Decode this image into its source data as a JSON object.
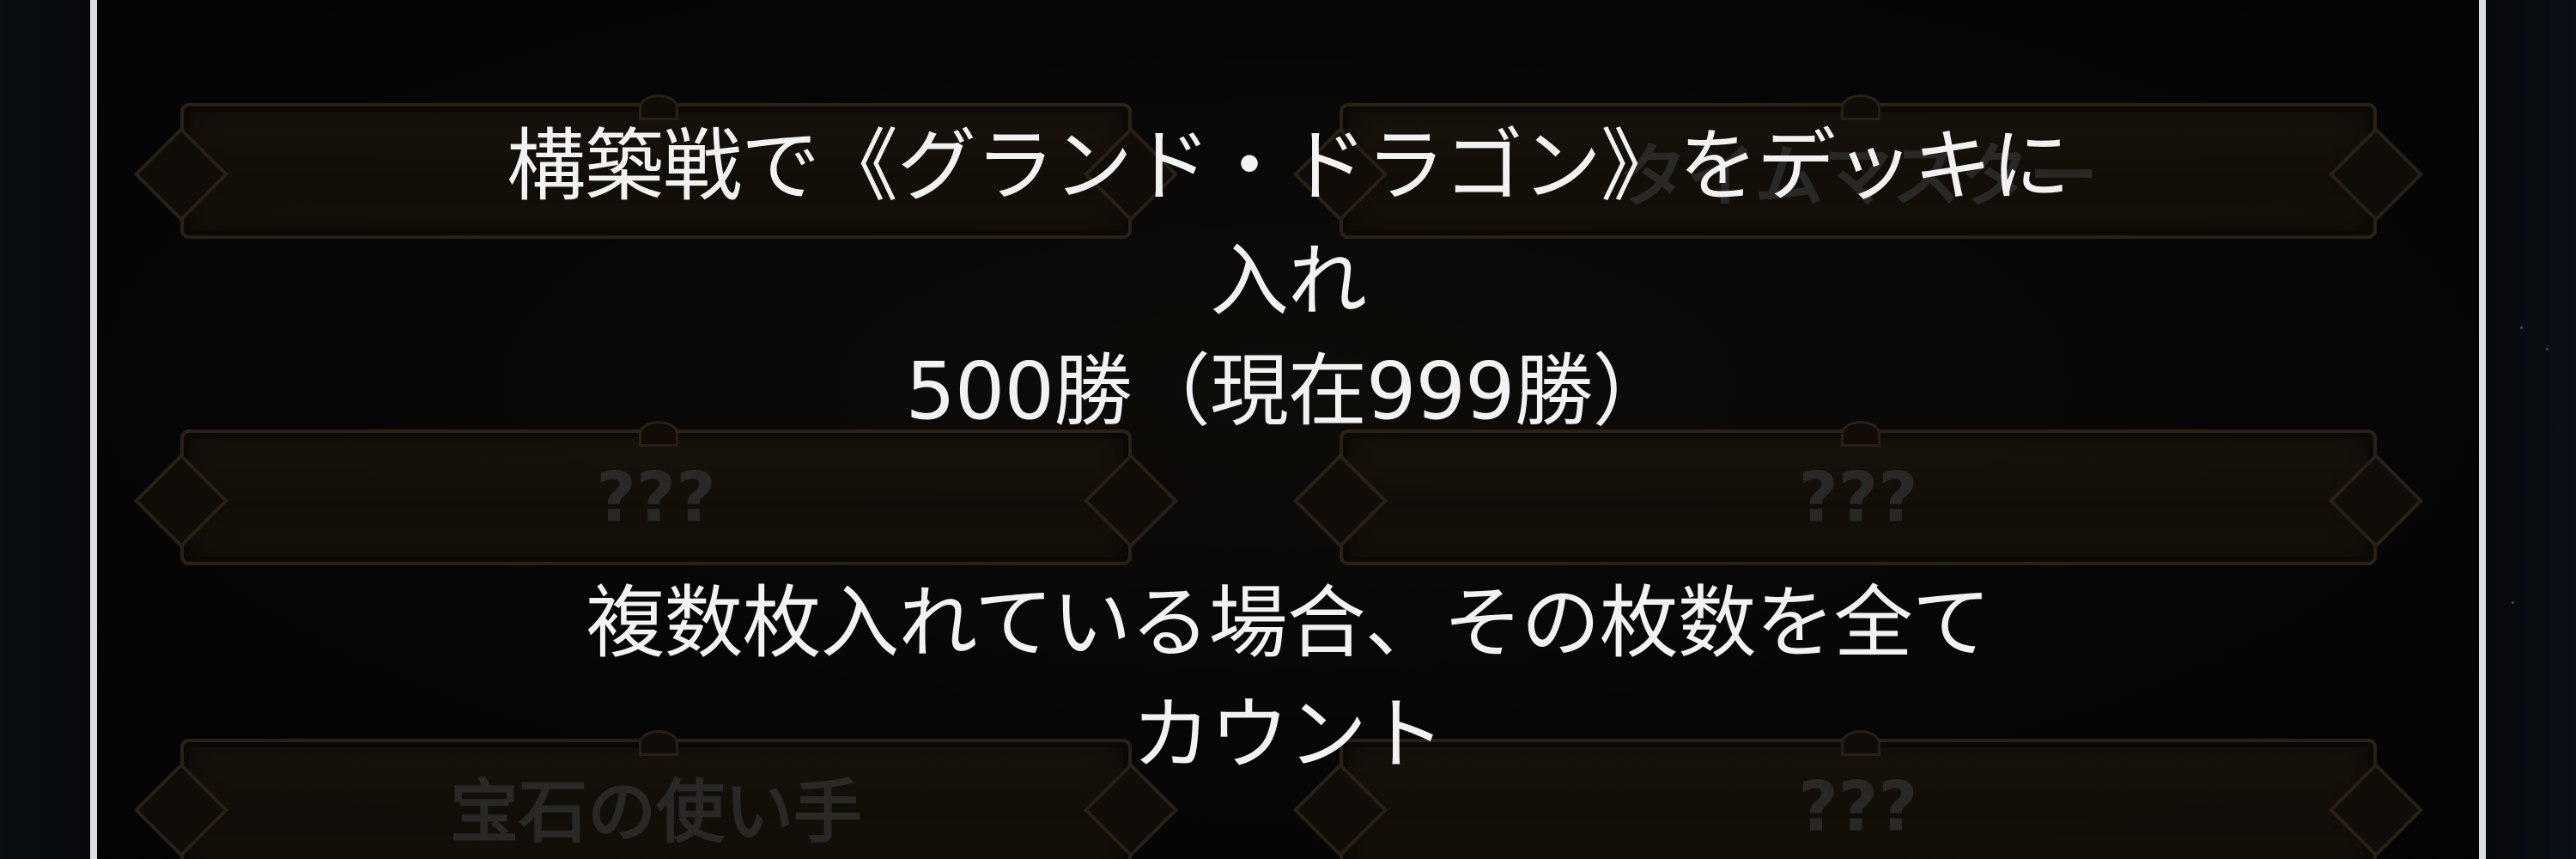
{
  "background_badges": [
    {
      "id": "r1c1",
      "label": ""
    },
    {
      "id": "r1c2",
      "label": "タイムマスター"
    },
    {
      "id": "r2c1",
      "label": "???"
    },
    {
      "id": "r2c2",
      "label": "???"
    },
    {
      "id": "r3c1",
      "label": "宝石の使い手"
    },
    {
      "id": "r3c2",
      "label": "???"
    }
  ],
  "condition": {
    "line1": "構築戦で《グランド・ドラゴン》をデッキに",
    "line2": "入れ",
    "line3": "500勝（現在999勝）",
    "note_line1": "複数枚入れている場合、その枚数を全て",
    "note_line2": "カウント"
  },
  "colors": {
    "text": "#f2f2f2",
    "frame": "#dedede",
    "background": "#050505",
    "plate": "#1e170f"
  }
}
